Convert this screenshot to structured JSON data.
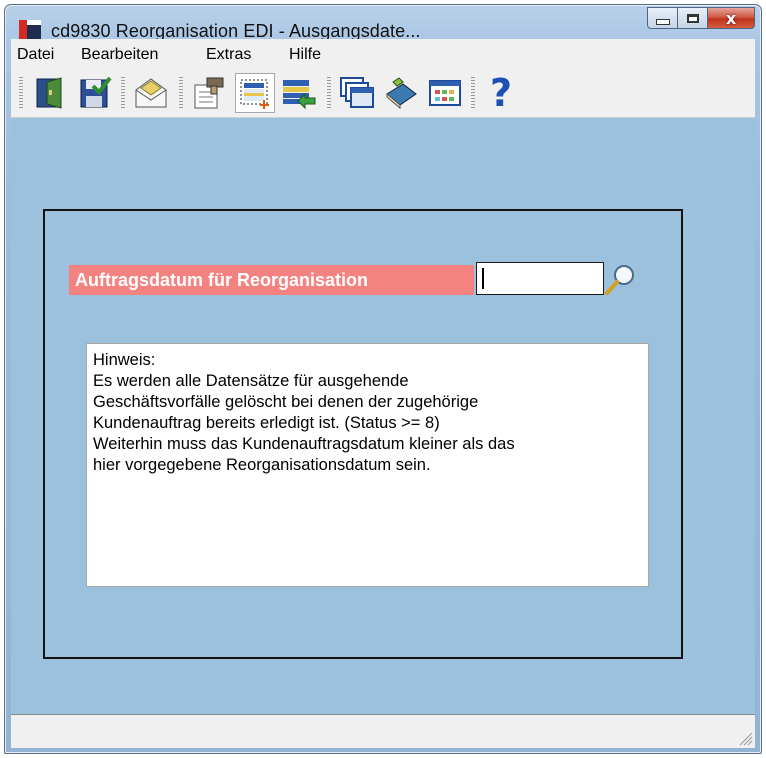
{
  "window": {
    "title": "cd9830 Reorganisation EDI - Ausgangsdate...",
    "close_symbol": "x"
  },
  "menu": {
    "items": [
      {
        "label": "Datei"
      },
      {
        "label": "Bearbeiten"
      },
      {
        "label": "Extras"
      },
      {
        "label": "Hilfe"
      }
    ]
  },
  "toolbar": {
    "buttons": [
      {
        "icon": "exit-door-icon"
      },
      {
        "icon": "save-check-icon"
      },
      {
        "icon": "envelope-icon"
      },
      {
        "icon": "edit-document-icon"
      },
      {
        "icon": "new-record-icon",
        "pressed": true
      },
      {
        "icon": "transfer-list-icon"
      },
      {
        "icon": "windows-stack-icon"
      },
      {
        "icon": "book-icon"
      },
      {
        "icon": "grid-table-icon"
      },
      {
        "icon": "help-icon",
        "symbol": "?"
      }
    ]
  },
  "form": {
    "date_label": "Auftragsdatum für Reorganisation",
    "date_value": "",
    "hint_lines": [
      "Hinweis:",
      "Es werden alle Datensätze für ausgehende",
      "Geschäftsvorfälle gelöscht bei denen der zugehörige",
      "Kundenauftrag bereits erledigt ist. (Status >= 8)",
      "Weiterhin muss das Kundenauftragsdatum kleiner als das",
      "hier vorgegebene Reorganisationsdatum sein."
    ]
  },
  "colors": {
    "content_bg": "#9bc1dd",
    "label_bg": "#f48280",
    "label_text": "#ffffff"
  }
}
